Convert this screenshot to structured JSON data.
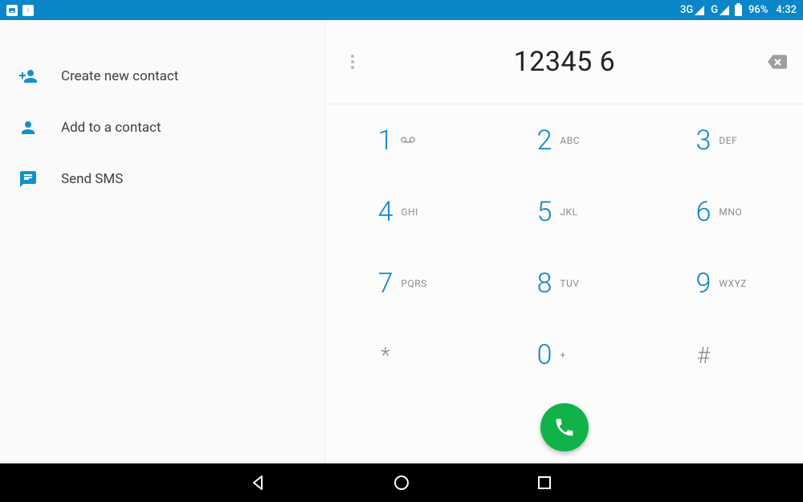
{
  "status": {
    "net1": "3G",
    "net2": "G",
    "battery_pct": "96%",
    "clock": "4:32"
  },
  "left_options": [
    {
      "icon": "person-add-icon",
      "label": "Create new contact"
    },
    {
      "icon": "person-icon",
      "label": "Add to a contact"
    },
    {
      "icon": "message-icon",
      "label": "Send SMS"
    }
  ],
  "dialer": {
    "number": "12345 6",
    "keys": [
      {
        "digit": "1",
        "sub": "",
        "voicemail": true
      },
      {
        "digit": "2",
        "sub": "ABC"
      },
      {
        "digit": "3",
        "sub": "DEF"
      },
      {
        "digit": "4",
        "sub": "GHI"
      },
      {
        "digit": "5",
        "sub": "JKL"
      },
      {
        "digit": "6",
        "sub": "MNO"
      },
      {
        "digit": "7",
        "sub": "PQRS"
      },
      {
        "digit": "8",
        "sub": "TUV"
      },
      {
        "digit": "9",
        "sub": "WXYZ"
      },
      {
        "sym": "*"
      },
      {
        "digit": "0",
        "sub": "+"
      },
      {
        "sym": "#"
      }
    ]
  }
}
